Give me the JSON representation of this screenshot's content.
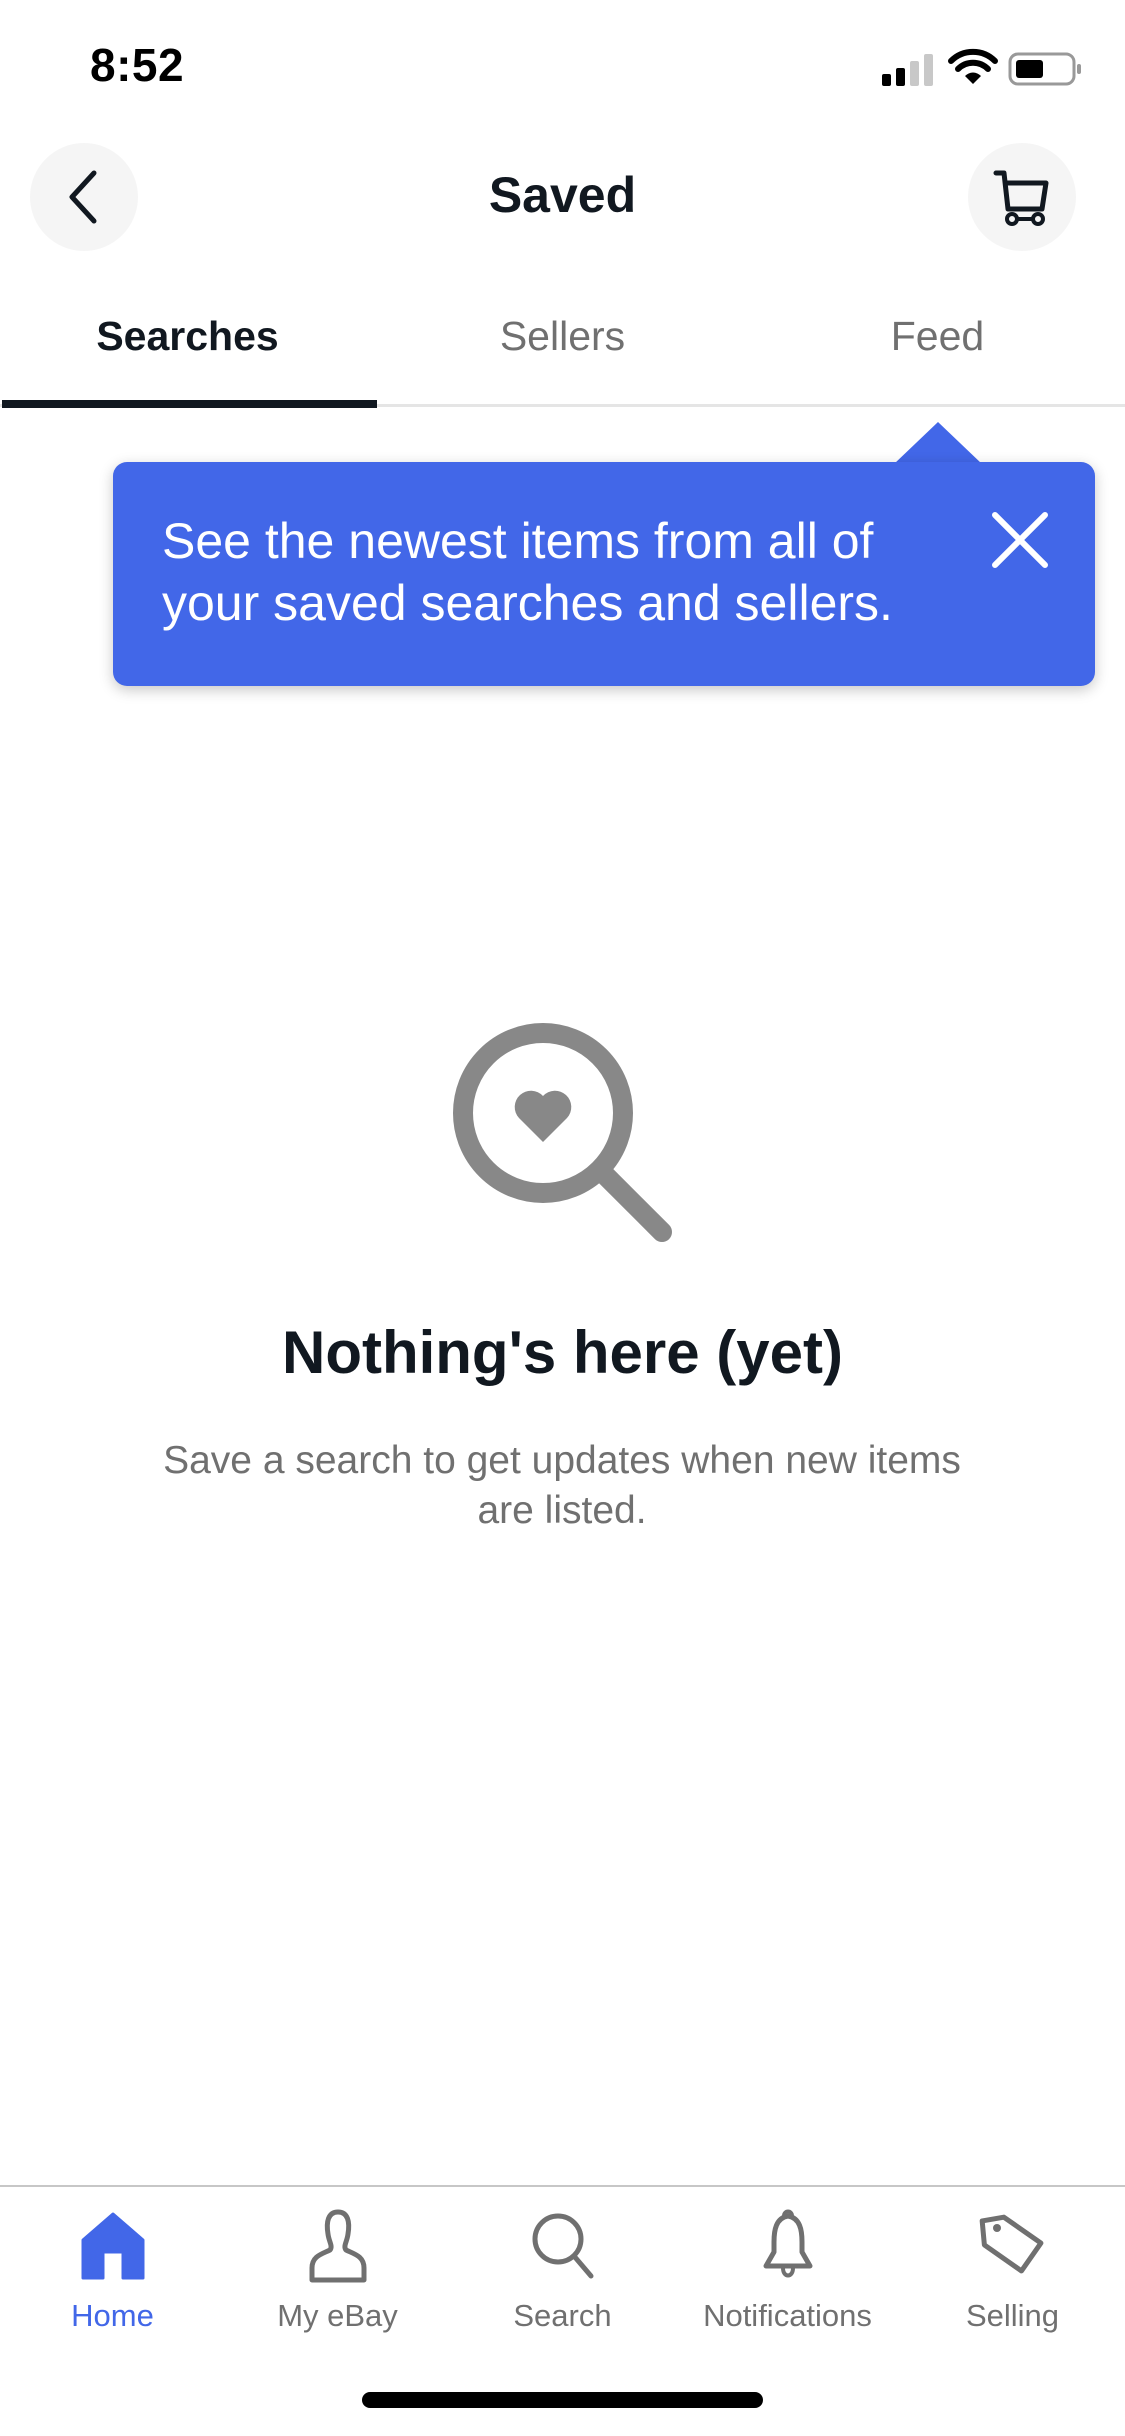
{
  "status_bar": {
    "time": "8:52",
    "signal_bars": 2,
    "signal_bars_total": 4,
    "battery_level": 0.5,
    "icons": [
      "signal-icon",
      "wifi-icon",
      "battery-icon"
    ]
  },
  "header": {
    "title": "Saved",
    "back_icon": "chevron-left-icon",
    "cart_icon": "cart-icon"
  },
  "tabs": [
    {
      "label": "Searches",
      "active": true
    },
    {
      "label": "Sellers",
      "active": false
    },
    {
      "label": "Feed",
      "active": false
    }
  ],
  "tooltip": {
    "text": "See the newest items from all of your saved searches and sellers.",
    "close_icon": "close-icon"
  },
  "empty_state": {
    "icon": "search-heart-icon",
    "title": "Nothing's here (yet)",
    "subtitle": "Save a search to get updates when new items are listed."
  },
  "bottom_nav": {
    "items": [
      {
        "label": "Home",
        "icon": "home-icon",
        "active": true
      },
      {
        "label": "My eBay",
        "icon": "person-icon",
        "active": false
      },
      {
        "label": "Search",
        "icon": "search-icon",
        "active": false
      },
      {
        "label": "Notifications",
        "icon": "bell-icon",
        "active": false
      },
      {
        "label": "Selling",
        "icon": "tag-icon",
        "active": false
      }
    ]
  },
  "colors": {
    "accent": "#4267e8",
    "text_primary": "#111820",
    "text_secondary": "#707070",
    "icon_gray": "#888888"
  }
}
